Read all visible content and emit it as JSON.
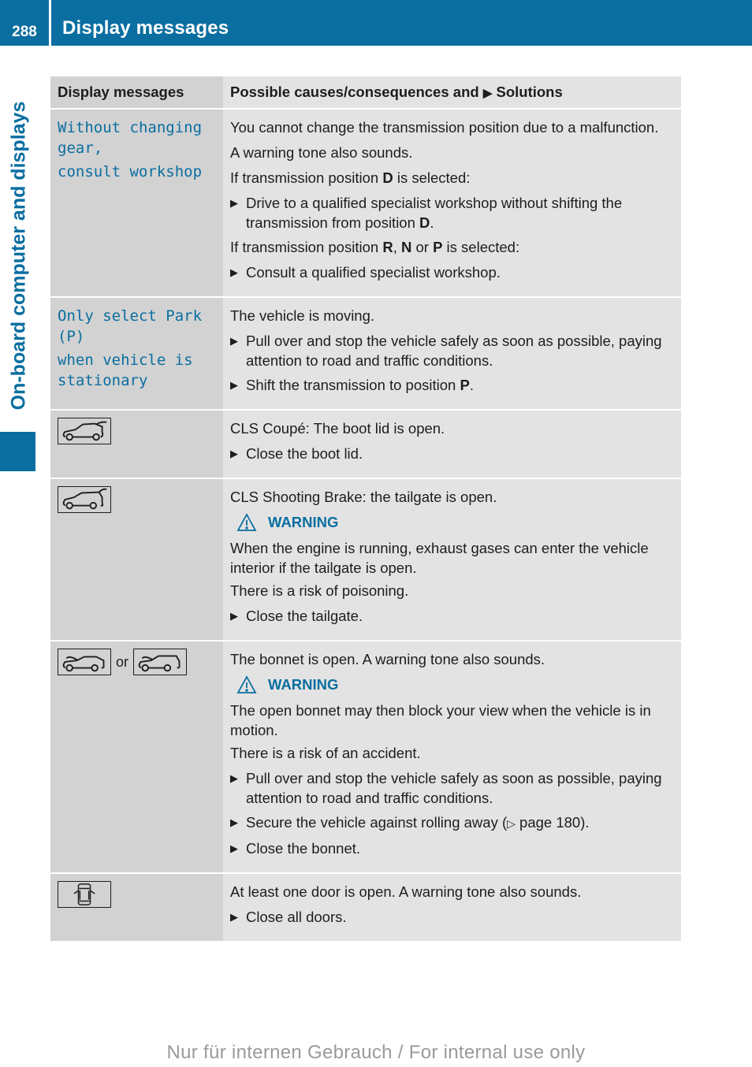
{
  "header": {
    "page_number": "288",
    "title": "Display messages"
  },
  "side_tab": {
    "label": "On-board computer and displays"
  },
  "table": {
    "headers": {
      "col1": "Display messages",
      "col2_pre": "Possible causes/consequences and ",
      "col2_arrow": "▶",
      "col2_post": " Solutions"
    },
    "rows": [
      {
        "message_lines": [
          "Without changing",
          "gear,",
          "consult workshop"
        ],
        "p1": "You cannot change the transmission position due to a malfunction.",
        "p2": "A warning tone also sounds.",
        "p3_pre": "If transmission position ",
        "p3_bold": "D",
        "p3_post": " is selected:",
        "b1_pre": "Drive to a qualified specialist workshop without shifting the transmission from position ",
        "b1_bold": "D",
        "b1_post": ".",
        "p4_pre": "If transmission position ",
        "p4_b1": "R",
        "p4_sep": ", ",
        "p4_b2": "N",
        "p4_or": " or ",
        "p4_b3": "P",
        "p4_post": " is selected:",
        "b2": "Consult a qualified specialist workshop."
      },
      {
        "message_lines": [
          "Only select Park",
          "(P)",
          "when vehicle is",
          "stationary"
        ],
        "p1": "The vehicle is moving.",
        "b1": "Pull over and stop the vehicle safely as soon as possible, paying attention to road and traffic conditions.",
        "b2_pre": "Shift the transmission to position ",
        "b2_bold": "P",
        "b2_post": "."
      },
      {
        "icon": "coupe-boot-open-icon",
        "p1": "CLS Coupé: The boot lid is open.",
        "b1": "Close the boot lid."
      },
      {
        "icon": "shooting-brake-tailgate-open-icon",
        "p1": "CLS Shooting Brake: the tailgate is open.",
        "warning_label": "WARNING",
        "p2": "When the engine is running, exhaust gases can enter the vehicle interior if the tailgate is open.",
        "p3": "There is a risk of poisoning.",
        "b1": "Close the tailgate."
      },
      {
        "icon_a": "coupe-bonnet-open-icon",
        "or_text": "or",
        "icon_b": "shooting-brake-bonnet-open-icon",
        "p1": "The bonnet is open. A warning tone also sounds.",
        "warning_label": "WARNING",
        "p2": "The open bonnet may then block your view when the vehicle is in motion.",
        "p3": "There is a risk of an accident.",
        "b1": "Pull over and stop the vehicle safely as soon as possible, paying attention to road and traffic conditions.",
        "b2_pre": "Secure the vehicle against rolling away (",
        "b2_ref_arrow": "▷",
        "b2_ref": " page 180",
        "b2_post": ").",
        "b3": "Close the bonnet."
      },
      {
        "icon": "door-open-icon",
        "p1": "At least one door is open. A warning tone also sounds.",
        "b1": "Close all doors."
      }
    ]
  },
  "footer": {
    "note": "Nur für internen Gebrauch / For internal use only"
  }
}
